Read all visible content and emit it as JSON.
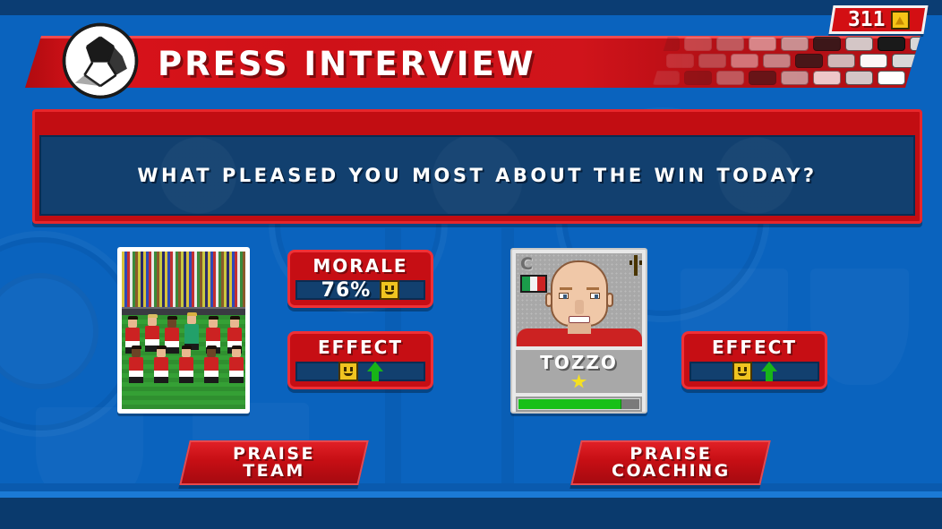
{
  "header": {
    "title": "PRESS INTERVIEW",
    "ball_icon": "football-icon",
    "currency": {
      "amount": "311",
      "icon": "coin-icon"
    }
  },
  "question": {
    "text": "WHAT PLEASED YOU MOST ABOUT THE WIN TODAY?"
  },
  "team_option": {
    "photo_alt": "team-photo",
    "morale": {
      "label": "MORALE",
      "value": "76%",
      "mood_icon": "smiley-happy-icon"
    },
    "effect": {
      "label": "EFFECT",
      "mood_icon": "smiley-happy-icon",
      "trend_icon": "arrow-up-icon"
    },
    "button": {
      "line1": "PRAISE",
      "line2": "TEAM"
    }
  },
  "coach_option": {
    "player_card": {
      "position": "C",
      "nationality_flag": "italy-flag",
      "name": "TOZZO",
      "star_icon": "star-icon",
      "mood_icon": "smiley-happy-icon",
      "condition_percent": 85
    },
    "effect": {
      "label": "EFFECT",
      "mood_icon": "smiley-happy-icon",
      "trend_icon": "arrow-up-icon"
    },
    "button": {
      "line1": "PRAISE",
      "line2": "COACHING"
    }
  },
  "colors": {
    "red_primary": "#c60e14",
    "red_light": "#ef3036",
    "blue_bg": "#0a63be",
    "blue_panel": "#12406f",
    "green_bar": "#17c017",
    "yellow_mood": "#f0c420"
  }
}
